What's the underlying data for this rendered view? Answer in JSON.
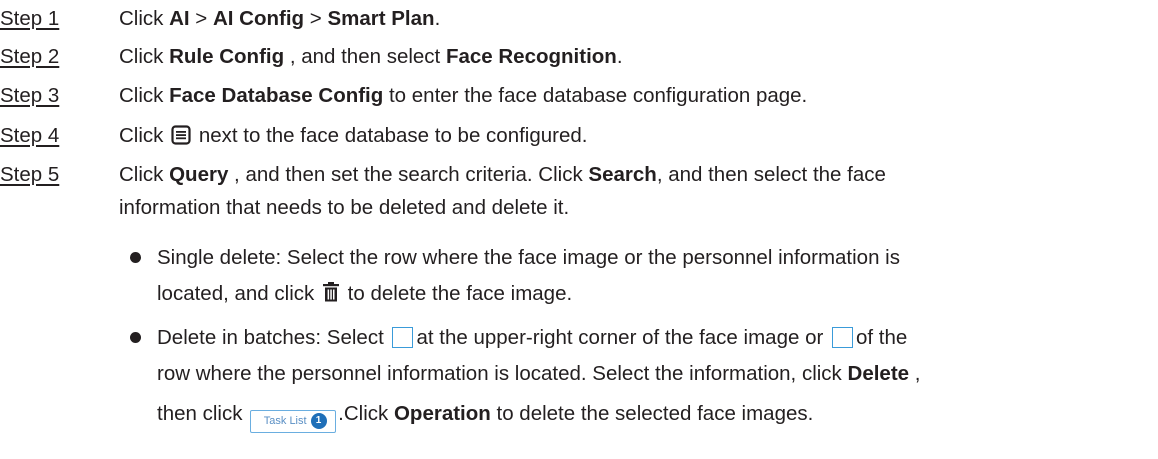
{
  "steps": [
    {
      "label": "Step 1",
      "parts": [
        "Click ",
        "AI",
        " > ",
        "AI Config",
        " > ",
        "Smart Plan",
        "."
      ]
    },
    {
      "label": "Step 2",
      "parts": [
        "Click ",
        "Rule Config",
        " , and then select ",
        "Face Recognition",
        "."
      ]
    },
    {
      "label": "Step 3",
      "parts": [
        "Click ",
        "Face Database Config",
        " to enter the face database configuration page."
      ]
    },
    {
      "label": "Step 4",
      "before_icon": "Click",
      "icon": "list-detail-icon",
      "after_icon": "next to the face database to be configured."
    },
    {
      "label": "Step 5",
      "parts": [
        "Click ",
        "Query",
        " , and then set the search criteria. Click ",
        "Search",
        ", and then select the face",
        "information that needs to be deleted and delete it."
      ]
    }
  ],
  "bullets": [
    {
      "line1": "Single delete: Select the row where the face image or the personnel information is",
      "line2_before": "located, and click",
      "icon": "trash-icon",
      "line2_after": "to delete the face image."
    },
    {
      "line1_before": "Delete in batches: Select",
      "icon": "checkbox-icon",
      "line1_mid": "at the upper-right corner of the face image or",
      "line1_after": "of the",
      "line2_before": "row where the personnel information is located. Select the information, click ",
      "line2_bold": "Delete",
      "line2_after": " ,",
      "line3_before": "then click",
      "button_label": "Task List",
      "button_badge": "1",
      "line3_mid": ".Click ",
      "line3_bold": "Operation",
      "line3_after": " to delete the selected face images."
    }
  ]
}
